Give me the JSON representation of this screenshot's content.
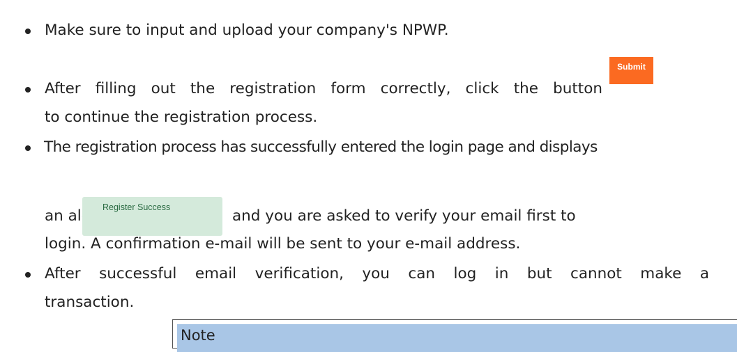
{
  "items": [
    {
      "lines": [
        "Make sure to input and upload your company's NPWP."
      ]
    },
    {
      "lines": [
        "After filling out the registration form correctly, click the button",
        "to continue the registration process."
      ],
      "button_label": "Submit"
    },
    {
      "lines": [
        "The registration process has successfully entered the login page and displays",
        "an alert",
        "and you are asked to verify your email first to",
        "login. A confirmation e-mail will be sent to your e-mail address."
      ],
      "alert_text": "Register Success"
    },
    {
      "lines": [
        "After successful email verification, you can log in but cannot make a",
        "transaction."
      ],
      "note_title": "Note"
    }
  ],
  "colors": {
    "submit_button": "#fb6a21",
    "alert_background": "#d4eadb",
    "alert_text": "#2a6b42",
    "note_header": "#a9c6e6"
  }
}
